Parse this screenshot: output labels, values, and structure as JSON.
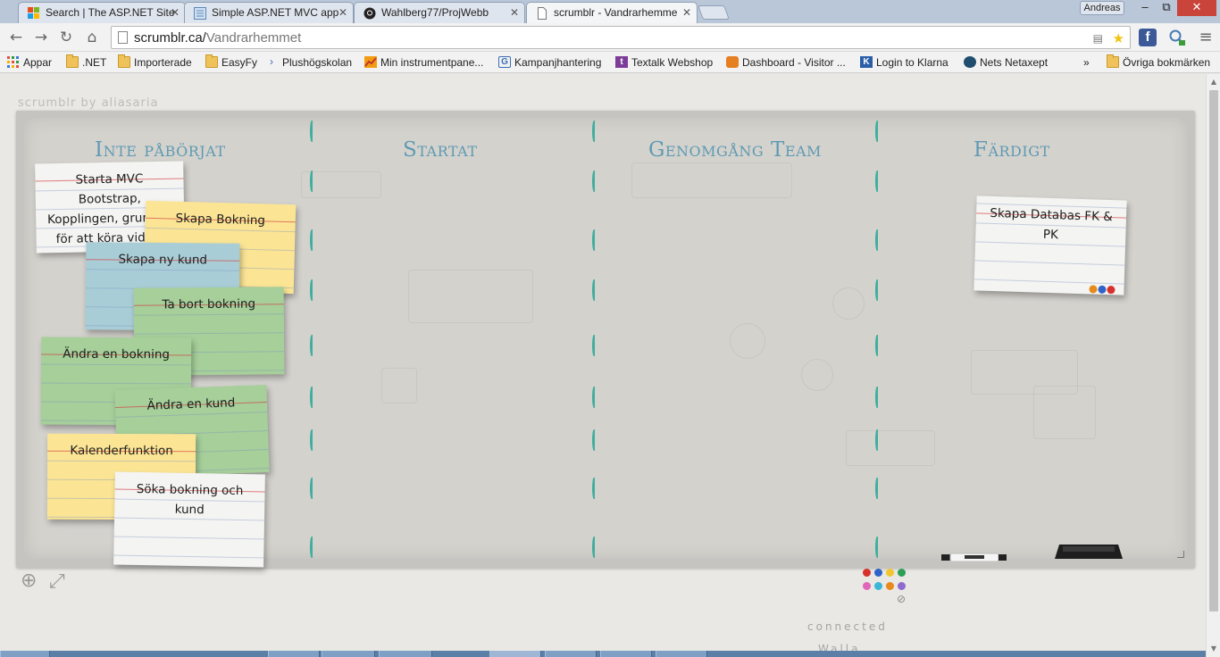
{
  "browser": {
    "tabs": [
      {
        "title": "Search | The ASP.NET Site",
        "icon": "windows-icon"
      },
      {
        "title": "Simple ASP.NET MVC app",
        "icon": "document-icon"
      },
      {
        "title": "Wahlberg77/ProjWebb",
        "icon": "github-icon"
      },
      {
        "title": "scrumblr - Vandrarhemme",
        "icon": "page-icon",
        "active": true
      }
    ],
    "user": "Andreas",
    "window_controls": {
      "minimize": "–",
      "maximize": "⧉",
      "close": "✕"
    },
    "nav": {
      "back": "←",
      "forward": "→",
      "reload": "↻",
      "home": "⌂"
    },
    "url_host": "scrumblr.ca/",
    "url_path": "Vandrarhemmet",
    "extensions": {
      "facebook": "f",
      "menu": "≡"
    },
    "bookmarks": [
      {
        "label": "Appar",
        "icon": "apps-grid-icon"
      },
      {
        "label": ".NET",
        "icon": "folder-icon"
      },
      {
        "label": "Importerade",
        "icon": "folder-icon"
      },
      {
        "label": "EasyFy",
        "icon": "folder-icon"
      },
      {
        "label": "Plushögskolan",
        "icon": "arrow-icon"
      },
      {
        "label": "Min instrumentpane...",
        "icon": "chart-icon"
      },
      {
        "label": "Kampanjhantering",
        "icon": "google-icon"
      },
      {
        "label": "Textalk Webshop",
        "icon": "textalk-icon"
      },
      {
        "label": "Dashboard - Visitor ...",
        "icon": "dashboard-icon"
      },
      {
        "label": "Login to Klarna",
        "icon": "klarna-icon"
      },
      {
        "label": "Nets Netaxept",
        "icon": "nets-icon"
      }
    ],
    "bookmarks_overflow": "»",
    "other_bookmarks": "Övriga bokmärken"
  },
  "page": {
    "brand": "scrumblr by aliasaria",
    "columns": [
      "Inte påbörjat",
      "Startat",
      "Genomgång Team",
      "Färdigt"
    ],
    "cards": [
      {
        "text": "Starta MVC Bootstrap, Kopplingen, grunden för att köra vidare",
        "color": "white"
      },
      {
        "text": "Skapa Bokning",
        "color": "yellow"
      },
      {
        "text": "Skapa ny kund",
        "color": "blue"
      },
      {
        "text": "Ta bort bokning",
        "color": "green"
      },
      {
        "text": "Ändra en bokning",
        "color": "green"
      },
      {
        "text": "Ändra en kund",
        "color": "green"
      },
      {
        "text": "Kalenderfunktion",
        "color": "yellow"
      },
      {
        "text": "Söka bokning och kund",
        "color": "white"
      },
      {
        "text": "Skapa Databas FK & PK",
        "color": "white"
      }
    ],
    "card_dot_colors": [
      "#e8891b",
      "#2f63c9",
      "#d8302c"
    ],
    "palette_colors": [
      "#d8302c",
      "#2f63c9",
      "#f2c62f",
      "#2e9e55",
      "#e066b8",
      "#3bb6d6",
      "#e8891b",
      "#8e6bd1"
    ],
    "tools": {
      "add": "⊕",
      "fullscreen": "⤢",
      "erase": "⊘"
    },
    "status": "connected",
    "partial_text": "Walla..."
  }
}
